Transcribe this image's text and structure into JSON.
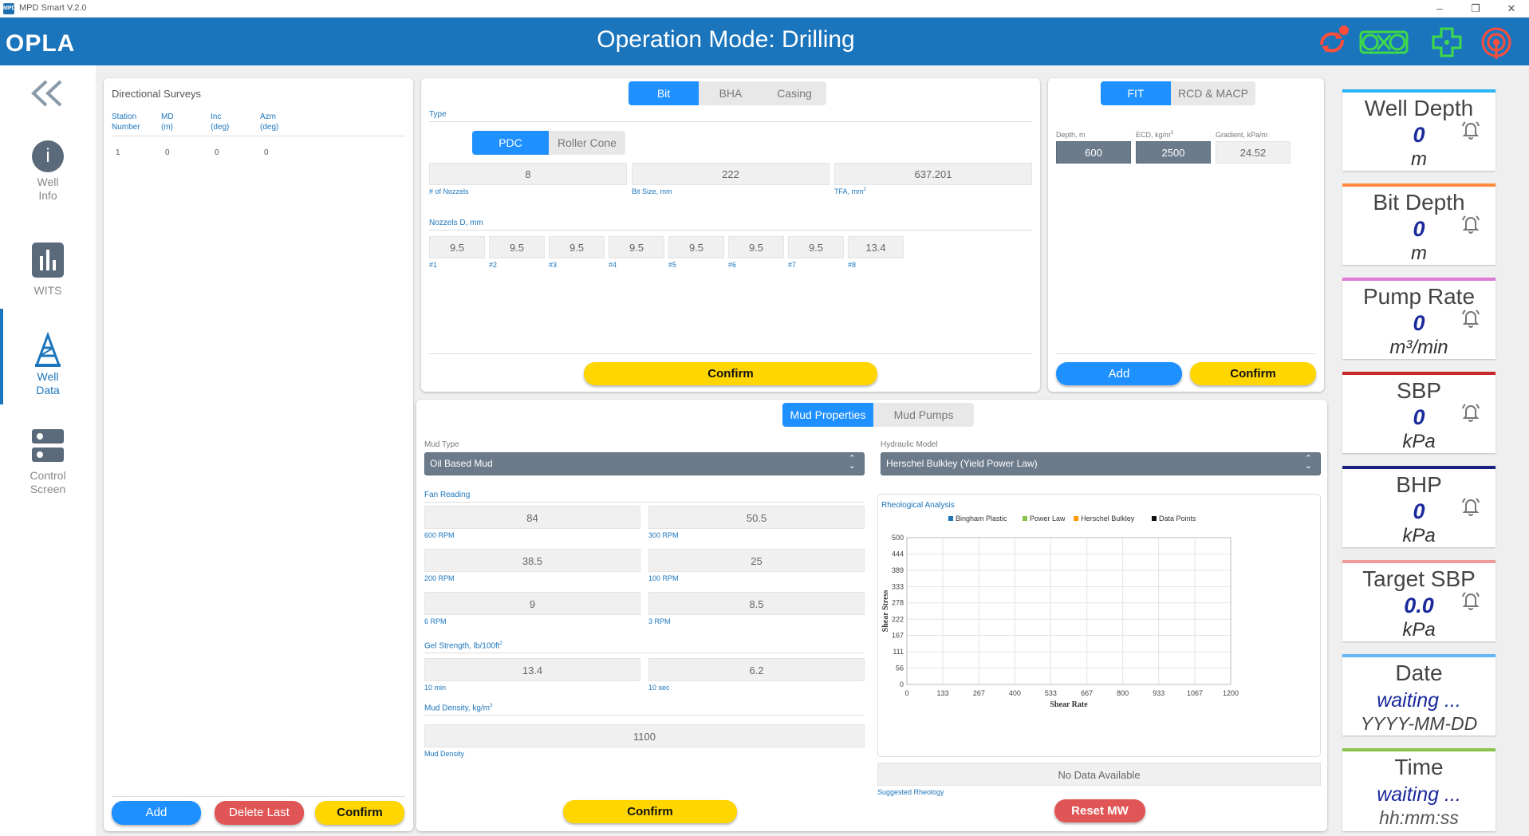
{
  "window": {
    "title": "MPD Smart V.2.0",
    "app_icon": "MPD"
  },
  "header": {
    "logo": "OPLA",
    "title": "Operation Mode: Drilling"
  },
  "sidebar": {
    "items": [
      {
        "label1": "Well",
        "label2": "Info"
      },
      {
        "label1": "WITS",
        "label2": ""
      },
      {
        "label1": "Well",
        "label2": "Data"
      },
      {
        "label1": "Control",
        "label2": "Screen"
      }
    ]
  },
  "surveys": {
    "title": "Directional Surveys",
    "columns": [
      [
        "Station",
        "Number"
      ],
      [
        "MD",
        "(m)"
      ],
      [
        "Inc",
        "(deg)"
      ],
      [
        "Azm",
        "(deg)"
      ]
    ],
    "row": [
      "1",
      "0",
      "0",
      "0"
    ],
    "buttons": {
      "add": "Add",
      "delete": "Delete Last",
      "confirm": "Confirm"
    }
  },
  "bit": {
    "tabs": [
      "Bit",
      "BHA",
      "Casing"
    ],
    "type_label": "Type",
    "type_options": [
      "PDC",
      "Roller Cone"
    ],
    "nozzles": "8",
    "nozzles_label": "# of Nozzels",
    "bit_size": "222",
    "bit_size_label": "Bit Size, mm",
    "tfa": "637.201",
    "tfa_label": "TFA, mm",
    "nozzle_d_label": "Nozzels D, mm",
    "nozzle_values": [
      "9.5",
      "9.5",
      "9.5",
      "9.5",
      "9.5",
      "9.5",
      "9.5",
      "13.4"
    ],
    "nozzle_labels": [
      "#1",
      "#2",
      "#3",
      "#4",
      "#5",
      "#6",
      "#7",
      "#8"
    ],
    "confirm": "Confirm"
  },
  "fit": {
    "tabs": [
      "FIT",
      "RCD & MACP"
    ],
    "depth_label": "Depth, m",
    "depth": "600",
    "ecd_label": "ECD, kg/m",
    "ecd": "2500",
    "gradient_label": "Gradient, kPa/m",
    "gradient": "24.52",
    "add": "Add",
    "confirm": "Confirm"
  },
  "mud": {
    "tabs": [
      "Mud Properties",
      "Mud Pumps"
    ],
    "mud_type_label": "Mud Type",
    "mud_type": "Oil Based Mud",
    "hyd_label": "Hydraulic Model",
    "hyd_model": "Herschel Bulkley (Yield Power Law)",
    "fan_label": "Fan Reading",
    "fan": [
      {
        "v": "84",
        "l": "600 RPM"
      },
      {
        "v": "50.5",
        "l": "300 RPM"
      },
      {
        "v": "38.5",
        "l": "200 RPM"
      },
      {
        "v": "25",
        "l": "100 RPM"
      },
      {
        "v": "9",
        "l": "6 RPM"
      },
      {
        "v": "8.5",
        "l": "3 RPM"
      }
    ],
    "gel_label": "Gel Strength, lb/100ft",
    "gel": [
      {
        "v": "13.4",
        "l": "10 min"
      },
      {
        "v": "6.2",
        "l": "10 sec"
      }
    ],
    "density_label": "Mud Density, kg/m",
    "density": "1100",
    "density_sub": "Mud Density",
    "confirm": "Confirm",
    "rheo_label": "Rheological Analysis",
    "no_data": "No Data Available",
    "suggested": "Suggested Rheology",
    "reset": "Reset MW"
  },
  "chart_data": {
    "type": "line",
    "legend": [
      "Bingham Plastic",
      "Power Law",
      "Herschel Bulkley",
      "Data Points"
    ],
    "legend_colors": [
      "#1f77b4",
      "#8bc34a",
      "#ff9800",
      "#111111"
    ],
    "xlabel": "Shear Rate",
    "ylabel": "Shear Stress",
    "xticks": [
      "0",
      "133",
      "267",
      "400",
      "533",
      "667",
      "800",
      "933",
      "1067",
      "1200"
    ],
    "yticks": [
      "0",
      "56",
      "111",
      "167",
      "222",
      "278",
      "333",
      "389",
      "444",
      "500"
    ],
    "xlim": [
      0,
      1200
    ],
    "ylim": [
      0,
      500
    ],
    "grid": true,
    "legend_position": "top",
    "series": []
  },
  "cards": [
    {
      "title": "Well Depth",
      "value": "0",
      "unit": "m",
      "color": "#29b6f6"
    },
    {
      "title": "Bit Depth",
      "value": "0",
      "unit": "m",
      "color": "#ff8a3d"
    },
    {
      "title": "Pump Rate",
      "value": "0",
      "unit": "m³/min",
      "color": "#e07ad8"
    },
    {
      "title": "SBP",
      "value": "0",
      "unit": "kPa",
      "color": "#c62828"
    },
    {
      "title": "BHP",
      "value": "0",
      "unit": "kPa",
      "color": "#1a237e"
    },
    {
      "title": "Target SBP",
      "value": "0.0",
      "unit": "kPa",
      "color": "#ef9a9a"
    },
    {
      "title": "Date",
      "value": "waiting ...",
      "unit": "YYYY-MM-DD",
      "color": "#64b5f6"
    },
    {
      "title": "Time",
      "value": "waiting ...",
      "unit": "hh:mm:ss",
      "color": "#8bc34a"
    }
  ],
  "colors": {
    "header": "#1b75bc",
    "accent": "#1e90ff",
    "confirm": "#ffd600",
    "reset": "#e05555",
    "value": "#1a2a9c"
  },
  "icons": [
    "sync-alert-icon",
    "drawworks-icon",
    "plus-cross-icon",
    "signal-antenna-icon",
    "bell-icon"
  ]
}
